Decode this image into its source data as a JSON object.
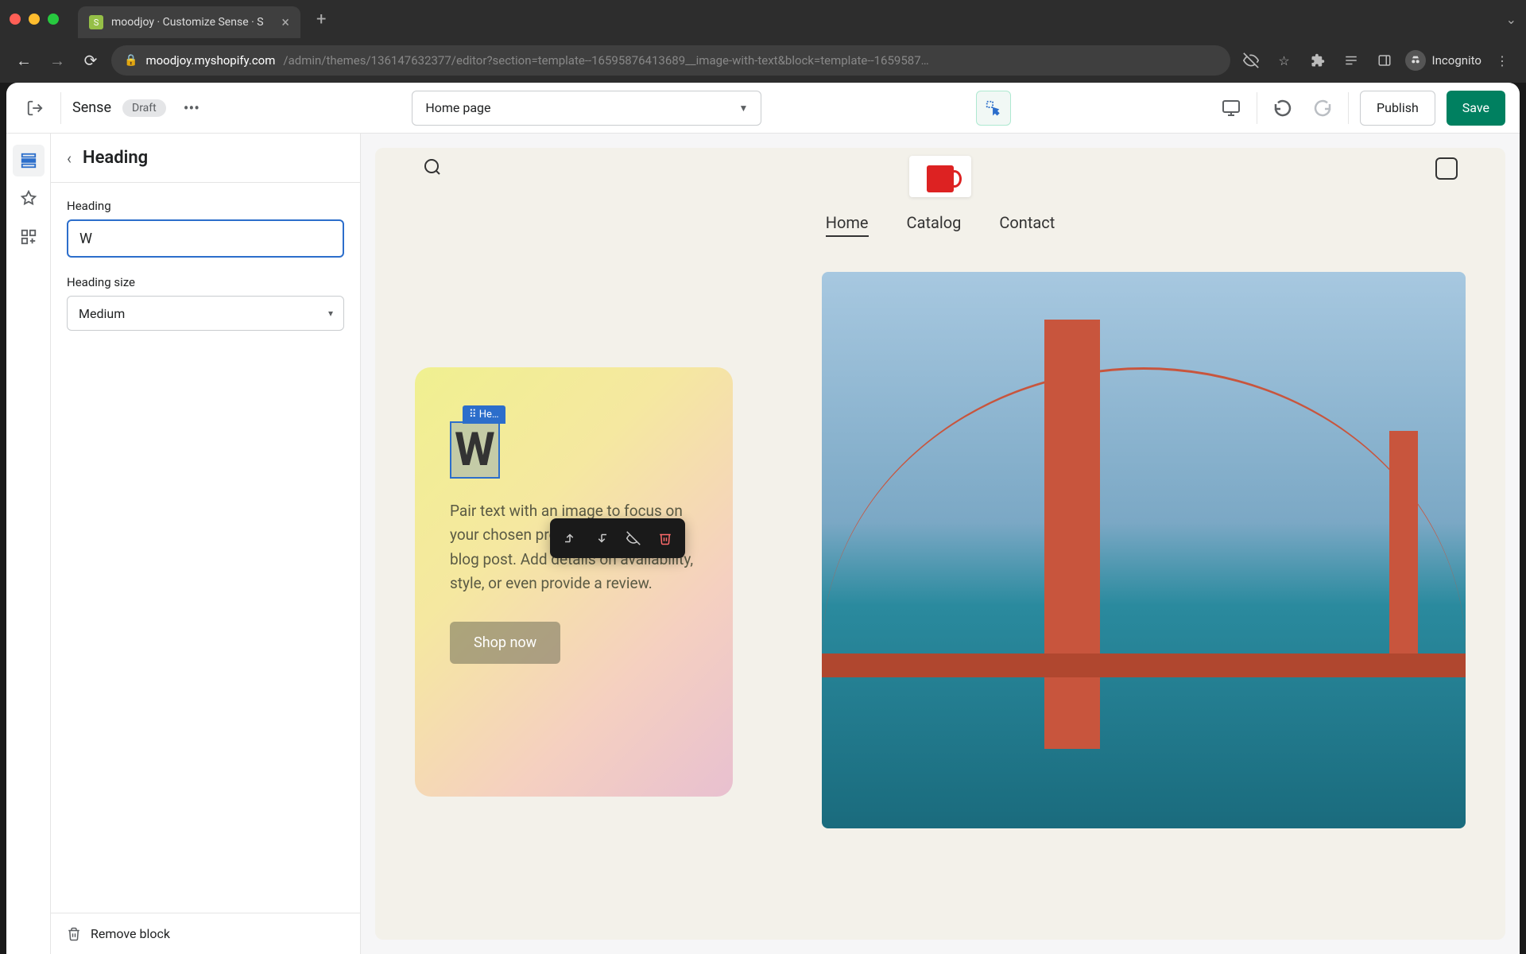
{
  "browser": {
    "tab_title": "moodjoy · Customize Sense · S",
    "url_domain": "moodjoy.myshopify.com",
    "url_path": "/admin/themes/136147632377/editor?section=template--16595876413689__image-with-text&block=template--1659587…",
    "incognito_label": "Incognito"
  },
  "topbar": {
    "theme_name": "Sense",
    "draft_label": "Draft",
    "page_selector": "Home page",
    "publish_label": "Publish",
    "save_label": "Save"
  },
  "sidebar": {
    "title": "Heading",
    "heading_field_label": "Heading",
    "heading_value": "W",
    "size_label": "Heading size",
    "size_value": "Medium",
    "remove_label": "Remove block"
  },
  "preview": {
    "nav": {
      "home": "Home",
      "catalog": "Catalog",
      "contact": "Contact"
    },
    "block_label": "He…",
    "heading_text": "W",
    "body_text": "Pair text with an image to focus on your chosen product, collection, or blog post. Add details on availability, style, or even provide a review.",
    "cta": "Shop now"
  }
}
